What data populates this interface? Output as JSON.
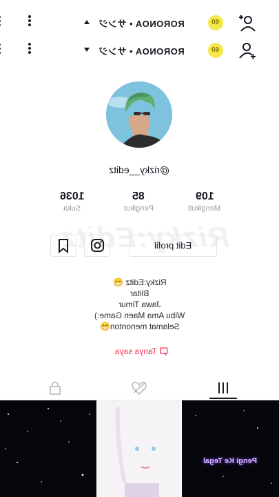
{
  "header_rows": [
    {
      "name": "RORONOA • サンジ",
      "coin": "60"
    },
    {
      "name": "RORONOA • サンジ",
      "coin": "60"
    }
  ],
  "profile": {
    "username": "@rizky__editz",
    "stats": [
      {
        "value": "109",
        "label": "Mengikuti"
      },
      {
        "value": "85",
        "label": "Pengikut"
      },
      {
        "value": "1036",
        "label": "Suka"
      }
    ],
    "watermark": "Rizky:Editz",
    "edit_label": "Edit profil",
    "bio": [
      "Rizky:Editz 😁",
      "Blitar",
      "Jawa Timur",
      "Wibu Ama Maen Game:)",
      "Selamat menonton😁"
    ],
    "ask_label": "Tanya saya"
  },
  "video_overlay_text": "Pengi Ke Tegal",
  "colors": {
    "accent": "#fe2c55",
    "coin": "#f6e84a",
    "text": "#161823",
    "muted": "#9b9b9b"
  },
  "icons": [
    "add-user-icon",
    "more-icon",
    "instagram-icon",
    "bookmark-icon",
    "grid-icon",
    "heart-hidden-icon",
    "lock-icon",
    "question-icon"
  ]
}
